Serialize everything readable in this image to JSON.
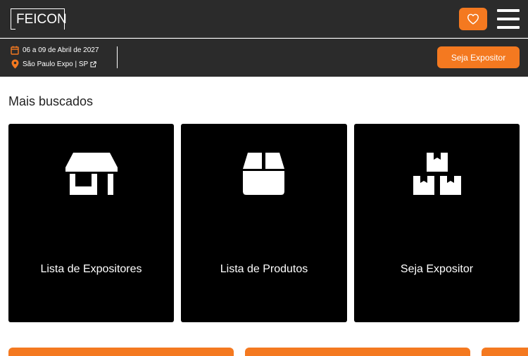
{
  "header": {
    "logo_text": "FEICON",
    "favorite_icon": "heart-icon",
    "menu_icon": "hamburger-menu-icon"
  },
  "event": {
    "date": "06 a 09 de Abril de 2027",
    "location": "São Paulo Expo | SP",
    "cta_label": "Seja Expositor"
  },
  "section": {
    "title": "Mais buscados"
  },
  "cards": [
    {
      "label": "Lista de Expositores",
      "icon": "store-icon"
    },
    {
      "label": "Lista de Produtos",
      "icon": "box-icon"
    },
    {
      "label": "Seja Expositor",
      "icon": "boxes-icon"
    }
  ],
  "colors": {
    "accent": "#f47920",
    "header_bg": "#2b2b2b",
    "card_bg": "#000000"
  }
}
